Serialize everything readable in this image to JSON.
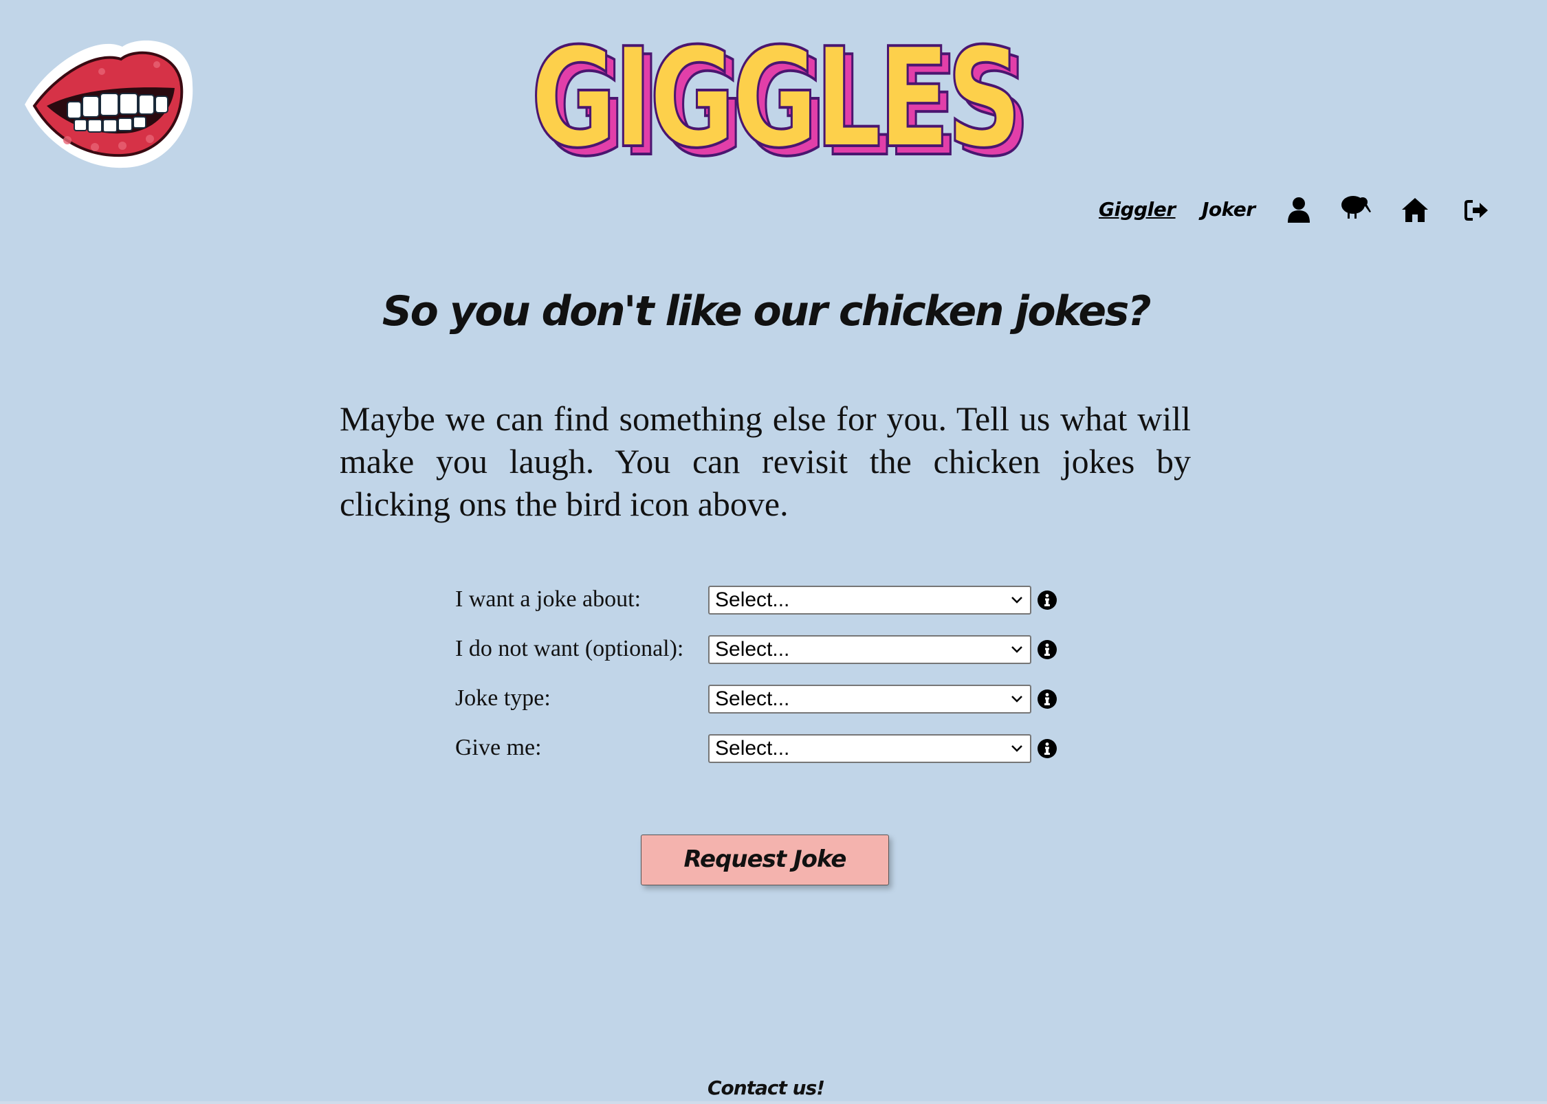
{
  "brand": {
    "logo_icon": "lips-icon",
    "title": "GIGGLES",
    "title_fill": "#fdd04b",
    "title_shadow": "#e23fa9",
    "title_outline": "#4a1670"
  },
  "nav": {
    "links": [
      {
        "label": "Giggler"
      },
      {
        "label": "Joker"
      }
    ],
    "icons": [
      "user-icon",
      "kiwi-bird-icon",
      "home-icon",
      "logout-icon"
    ]
  },
  "main": {
    "headline": "So you don't like our chicken jokes?",
    "intro": "Maybe we can find something else for you. Tell us what will make you laugh. You can revisit the chicken jokes by clicking ons the bird icon above."
  },
  "form": {
    "fields": [
      {
        "label": "I want a joke about:",
        "value": "Select..."
      },
      {
        "label": "I do not want (optional):",
        "value": "Select..."
      },
      {
        "label": "Joke type:",
        "value": "Select..."
      },
      {
        "label": "Give me:",
        "value": "Select..."
      }
    ],
    "submit_label": "Request Joke",
    "submit_color": "#f4b3ae"
  },
  "footer": {
    "contact_label": "Contact us!"
  },
  "colors": {
    "background": "#c1d5e8"
  }
}
